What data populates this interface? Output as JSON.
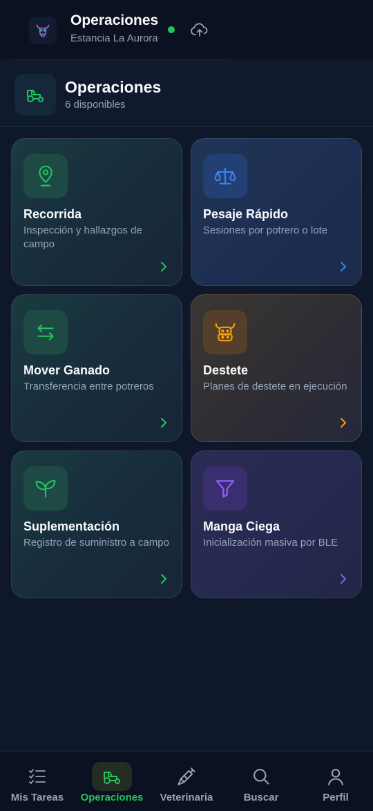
{
  "header": {
    "title": "Operaciones",
    "subtitle": "Estancia La Aurora",
    "status": "online",
    "logo_icon": "cow-logo-icon",
    "sync_icon": "cloud-upload-icon"
  },
  "section": {
    "title": "Operaciones",
    "subtitle": "6 disponibles",
    "icon": "tractor-icon"
  },
  "cards": [
    {
      "title": "Recorrida",
      "description": "Inspección y hallazgos de campo",
      "icon": "map-pin-icon",
      "accent": "#22c55e"
    },
    {
      "title": "Pesaje Rápido",
      "description": "Sesiones por potrero o lote",
      "icon": "scale-icon",
      "accent": "#3b82f6"
    },
    {
      "title": "Mover Ganado",
      "description": "Transferencia entre potreros",
      "icon": "arrows-transfer-icon",
      "accent": "#22c55e"
    },
    {
      "title": "Destete",
      "description": "Planes de destete en ejecución",
      "icon": "cow-icon",
      "accent": "#f59e0b"
    },
    {
      "title": "Suplementación",
      "description": "Registro de suministro a campo",
      "icon": "sprout-icon",
      "accent": "#22c55e"
    },
    {
      "title": "Manga Ciega",
      "description": "Inicialización masiva por BLE",
      "icon": "funnel-icon",
      "accent": "#8b5cf6"
    }
  ],
  "nav": [
    {
      "label": "Mis Tareas",
      "icon": "checklist-icon",
      "active": false
    },
    {
      "label": "Operaciones",
      "icon": "tractor-icon",
      "active": true
    },
    {
      "label": "Veterinaria",
      "icon": "syringe-icon",
      "active": false
    },
    {
      "label": "Buscar",
      "icon": "search-icon",
      "active": false
    },
    {
      "label": "Perfil",
      "icon": "user-icon",
      "active": false
    }
  ],
  "colors": {
    "accent_green": "#22c55e",
    "accent_blue": "#3b82f6",
    "accent_amber": "#f59e0b",
    "accent_purple": "#8b5cf6",
    "background": "#0f172a"
  }
}
